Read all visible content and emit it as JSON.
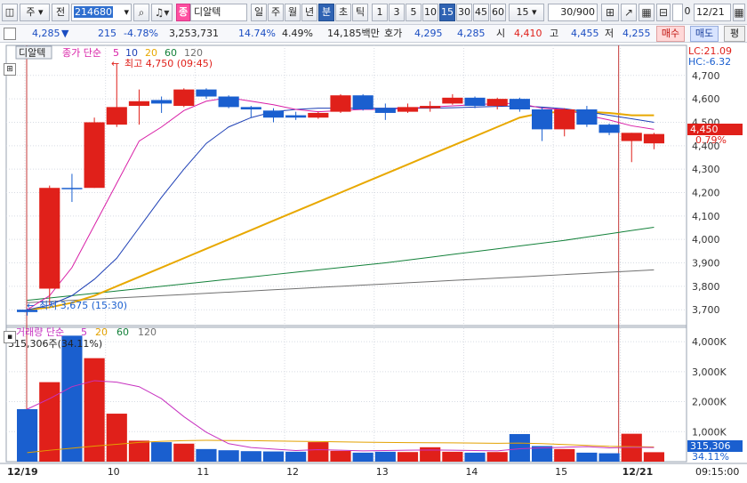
{
  "toolbar": {
    "mode_primary": "주",
    "mode_all": "전",
    "stock_code": "214680",
    "stock_badge": "종",
    "stock_name": "디알텍",
    "periods": [
      "일",
      "주",
      "월",
      "년",
      "분",
      "초",
      "틱"
    ],
    "active_period": "분",
    "intervals": [
      "1",
      "3",
      "5",
      "10",
      "15",
      "30",
      "45",
      "60"
    ],
    "active_interval": "15",
    "interval_select": "15",
    "count": "30",
    "count_total": "/900",
    "date": "12/21",
    "checkbox_label": "0"
  },
  "quote": {
    "price": "4,285",
    "change_arrow": "▼",
    "change": "215",
    "change_pct": "-4.78%",
    "volume": "3,253,731",
    "turnover_pct": "14.74%",
    "volume_ratio": "4.49%",
    "amount": "14,185백만",
    "ask_label": "호가",
    "ask1": "4,295",
    "ask2": "4,285",
    "open_label": "시",
    "open": "4,410",
    "high_label": "고",
    "high": "4,455",
    "low_label": "저",
    "low": "4,255",
    "buy_label": "매수",
    "sell_label": "매도",
    "eval_label": "평"
  },
  "price_legend": {
    "tab": "디알텍",
    "ma_title": "종가 단순",
    "ma_periods": [
      "5",
      "10",
      "20",
      "60",
      "120"
    ],
    "max_marker": "최고 4,750 (09:45)",
    "min_marker": "최저 3,675 (15:30)",
    "lc": "LC:21.09",
    "hc": "HC:-6.32",
    "last_price": "4,450",
    "last_pct": "0.79%"
  },
  "volume_legend": {
    "title": "거래량 단순",
    "ma_periods": [
      "5",
      "20",
      "60",
      "120"
    ],
    "current": "315,306주(34.11%)",
    "last_volume": "315,306",
    "last_pct": "34.11%"
  },
  "time_axis": {
    "start_label": "12/19",
    "end_label": "12/21",
    "clock": "09:15:00"
  },
  "colors": {
    "up": "#e0201a",
    "down": "#1a5fcf",
    "ma5": "#d81ea6",
    "ma10": "#1d3fb5",
    "ma20": "#e8a800",
    "ma60": "#13813a",
    "ma120": "#707070",
    "vol_ma5": "#c732c0",
    "vol_ma20": "#e3a100",
    "cursor": "#c43a3a"
  },
  "chart_data": {
    "type": "candlestick",
    "y_ticks": [
      4700,
      4600,
      4500,
      4400,
      4300,
      4200,
      4100,
      4000,
      3900,
      3800,
      3700
    ],
    "y_tick_labels": [
      "4,700",
      "4,600",
      "4,500",
      "4,400",
      "4,300",
      "4,200",
      "4,100",
      "4,000",
      "3,900",
      "3,800",
      "3,700"
    ],
    "vol_ticks": [
      4000,
      3000,
      2000,
      1000
    ],
    "vol_tick_labels": [
      "4,000K",
      "3,000K",
      "2,000K",
      "1,000K"
    ],
    "x_labels": [
      "12/19",
      "10",
      "11",
      "12",
      "13",
      "14",
      "15",
      "12/21"
    ],
    "x_label_index": [
      0,
      4,
      8,
      12,
      16,
      20,
      24,
      27
    ],
    "candles": [
      {
        "o": 3700,
        "h": 3705,
        "l": 3675,
        "c": 3690
      },
      {
        "o": 3790,
        "h": 4230,
        "l": 3720,
        "c": 4220
      },
      {
        "o": 4220,
        "h": 4280,
        "l": 4160,
        "c": 4215
      },
      {
        "o": 4220,
        "h": 4520,
        "l": 4220,
        "c": 4500
      },
      {
        "o": 4490,
        "h": 4750,
        "l": 4480,
        "c": 4565
      },
      {
        "o": 4570,
        "h": 4640,
        "l": 4490,
        "c": 4590
      },
      {
        "o": 4595,
        "h": 4610,
        "l": 4540,
        "c": 4580
      },
      {
        "o": 4570,
        "h": 4645,
        "l": 4565,
        "c": 4640
      },
      {
        "o": 4640,
        "h": 4645,
        "l": 4600,
        "c": 4610
      },
      {
        "o": 4610,
        "h": 4615,
        "l": 4560,
        "c": 4565
      },
      {
        "o": 4565,
        "h": 4570,
        "l": 4520,
        "c": 4555
      },
      {
        "o": 4550,
        "h": 4560,
        "l": 4500,
        "c": 4520
      },
      {
        "o": 4530,
        "h": 4545,
        "l": 4510,
        "c": 4520
      },
      {
        "o": 4520,
        "h": 4545,
        "l": 4515,
        "c": 4540
      },
      {
        "o": 4545,
        "h": 4620,
        "l": 4540,
        "c": 4615
      },
      {
        "o": 4615,
        "h": 4620,
        "l": 4550,
        "c": 4555
      },
      {
        "o": 4560,
        "h": 4580,
        "l": 4510,
        "c": 4540
      },
      {
        "o": 4545,
        "h": 4580,
        "l": 4540,
        "c": 4565
      },
      {
        "o": 4560,
        "h": 4590,
        "l": 4545,
        "c": 4570
      },
      {
        "o": 4580,
        "h": 4620,
        "l": 4575,
        "c": 4605
      },
      {
        "o": 4605,
        "h": 4610,
        "l": 4560,
        "c": 4570
      },
      {
        "o": 4570,
        "h": 4605,
        "l": 4555,
        "c": 4600
      },
      {
        "o": 4600,
        "h": 4605,
        "l": 4545,
        "c": 4555
      },
      {
        "o": 4555,
        "h": 4565,
        "l": 4420,
        "c": 4470
      },
      {
        "o": 4470,
        "h": 4560,
        "l": 4440,
        "c": 4555
      },
      {
        "o": 4555,
        "h": 4570,
        "l": 4480,
        "c": 4490
      },
      {
        "o": 4490,
        "h": 4495,
        "l": 4445,
        "c": 4455
      },
      {
        "o": 4420,
        "h": 4455,
        "l": 4330,
        "c": 4455
      },
      {
        "o": 4410,
        "h": 4455,
        "l": 4385,
        "c": 4450
      }
    ],
    "ma5": [
      3700,
      3760,
      3880,
      4060,
      4240,
      4420,
      4480,
      4550,
      4590,
      4605,
      4590,
      4575,
      4555,
      4545,
      4550,
      4555,
      4555,
      4560,
      4565,
      4570,
      4575,
      4580,
      4580,
      4560,
      4555,
      4530,
      4510,
      4485,
      4470
    ],
    "ma10": [
      3700,
      3720,
      3760,
      3830,
      3920,
      4050,
      4180,
      4300,
      4410,
      4480,
      4520,
      4545,
      4555,
      4560,
      4560,
      4560,
      4560,
      4560,
      4560,
      4562,
      4565,
      4568,
      4570,
      4565,
      4558,
      4545,
      4530,
      4515,
      4500
    ],
    "ma20": [
      3700,
      3710,
      3730,
      3760,
      3800,
      3840,
      3880,
      3920,
      3960,
      4000,
      4040,
      4080,
      4120,
      4160,
      4200,
      4240,
      4280,
      4320,
      4360,
      4400,
      4440,
      4480,
      4520,
      4540,
      4545,
      4545,
      4540,
      4530,
      4530
    ],
    "ma60": [
      3740,
      3750,
      3760,
      3770,
      3780,
      3790,
      3800,
      3810,
      3820,
      3830,
      3840,
      3850,
      3860,
      3870,
      3880,
      3890,
      3900,
      3912,
      3924,
      3936,
      3948,
      3960,
      3972,
      3984,
      3996,
      4010,
      4024,
      4038,
      4052
    ],
    "ma120": [
      3730,
      3735,
      3740,
      3745,
      3750,
      3755,
      3760,
      3765,
      3770,
      3775,
      3780,
      3785,
      3790,
      3795,
      3800,
      3805,
      3810,
      3815,
      3820,
      3825,
      3830,
      3835,
      3840,
      3845,
      3850,
      3855,
      3860,
      3865,
      3870
    ],
    "volumes": [
      1750,
      2650,
      4200,
      3450,
      1600,
      700,
      650,
      600,
      420,
      380,
      350,
      340,
      330,
      650,
      360,
      300,
      330,
      320,
      480,
      330,
      300,
      320,
      920,
      520,
      420,
      300,
      280,
      930,
      315
    ],
    "vol_ma5": [
      1750,
      2100,
      2500,
      2700,
      2650,
      2500,
      2100,
      1500,
      980,
      600,
      470,
      420,
      370,
      400,
      380,
      360,
      370,
      380,
      390,
      380,
      370,
      360,
      430,
      460,
      480,
      500,
      460,
      480,
      470
    ],
    "vol_ma20": [
      300,
      380,
      450,
      520,
      580,
      640,
      680,
      700,
      710,
      705,
      700,
      690,
      680,
      670,
      660,
      650,
      640,
      635,
      630,
      625,
      620,
      610,
      620,
      600,
      570,
      540,
      510,
      500,
      490
    ]
  }
}
